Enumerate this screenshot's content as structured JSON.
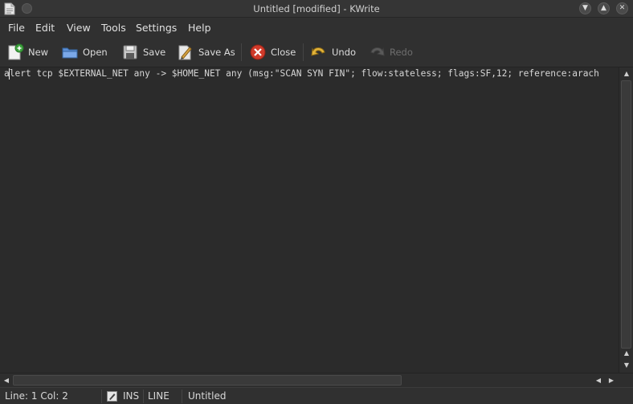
{
  "window": {
    "title": "Untitled [modified] - KWrite",
    "controls": [
      "chevron-down-icon",
      "chevron-up-icon",
      "close-icon"
    ]
  },
  "menubar": {
    "items": [
      {
        "label": "File"
      },
      {
        "label": "Edit"
      },
      {
        "label": "View"
      },
      {
        "label": "Tools"
      },
      {
        "label": "Settings"
      },
      {
        "label": "Help"
      }
    ]
  },
  "toolbar": {
    "new_label": "New",
    "open_label": "Open",
    "save_label": "Save",
    "saveas_label": "Save As",
    "close_label": "Close",
    "undo_label": "Undo",
    "redo_label": "Redo",
    "redo_enabled": false
  },
  "editor": {
    "lines": [
      "alert tcp $EXTERNAL_NET any -> $HOME_NET any (msg:\"SCAN SYN FIN\"; flow:stateless; flags:SF,12; reference:arach"
    ]
  },
  "statusbar": {
    "position": "Line: 1 Col: 2",
    "mode": "INS",
    "selection_mode": "LINE",
    "document": "Untitled"
  },
  "colors": {
    "background": "#2d2d2d",
    "close_red": "#d03a2a",
    "undo_yellow": "#e2b33a"
  }
}
